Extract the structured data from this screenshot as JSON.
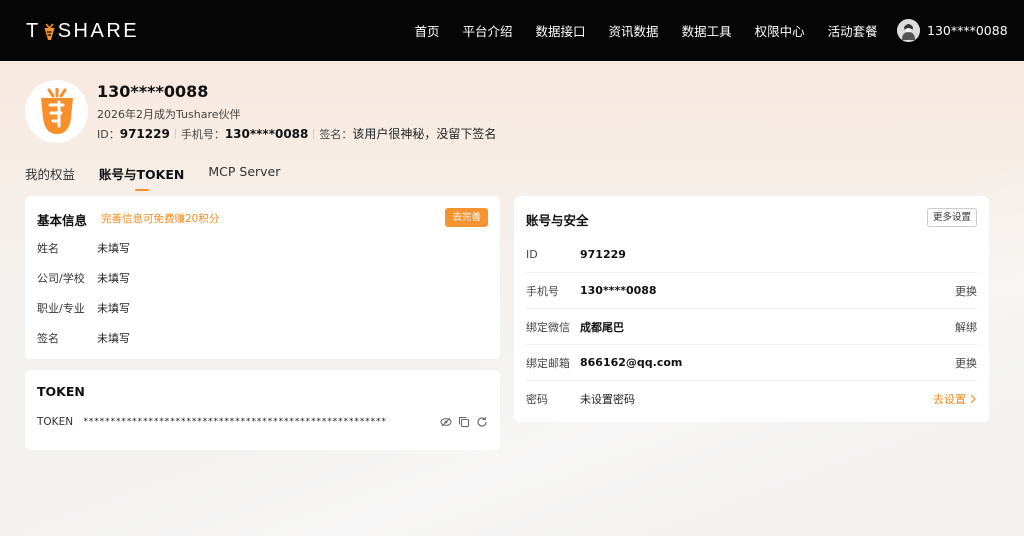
{
  "brand": {
    "name_left": "T",
    "name_right": "SHARE",
    "accent": "#f7902b"
  },
  "nav": {
    "items": [
      "首页",
      "平台介绍",
      "数据接口",
      "资讯数据",
      "数据工具",
      "权限中心",
      "活动套餐"
    ],
    "username": "130****0088"
  },
  "profile": {
    "name": "130****0088",
    "since": "2026年2月成为Tushare伙伴",
    "id_label": "ID：",
    "id_value": "971229",
    "phone_label": "手机号：",
    "phone_value": "130****0088",
    "sign_label": "签名：",
    "sign_value": "该用户很神秘，没留下签名"
  },
  "tabs": [
    "我的权益",
    "账号与TOKEN",
    "MCP Server"
  ],
  "basic": {
    "title": "基本信息",
    "hint": "完善信息可免费赚20积分",
    "button": "去完善",
    "rows": [
      {
        "label": "姓名",
        "value": "未填写"
      },
      {
        "label": "公司/学校",
        "value": "未填写"
      },
      {
        "label": "职业/专业",
        "value": "未填写"
      },
      {
        "label": "签名",
        "value": "未填写"
      }
    ]
  },
  "token": {
    "title": "TOKEN",
    "label": "TOKEN",
    "value": "********************************************************",
    "icons": [
      "eye-off-icon",
      "copy-icon",
      "refresh-icon"
    ]
  },
  "security": {
    "title": "账号与安全",
    "button": "更多设置",
    "rows": [
      {
        "label": "ID",
        "value": "971229",
        "action": ""
      },
      {
        "label": "手机号",
        "value": "130****0088",
        "action": "更换"
      },
      {
        "label": "绑定微信",
        "value": "成都尾巴",
        "action": "解绑"
      },
      {
        "label": "绑定邮箱",
        "value": "866162@qq.com",
        "action": "更换"
      },
      {
        "label": "密码",
        "value": "未设置密码",
        "action": "去设置"
      }
    ]
  }
}
